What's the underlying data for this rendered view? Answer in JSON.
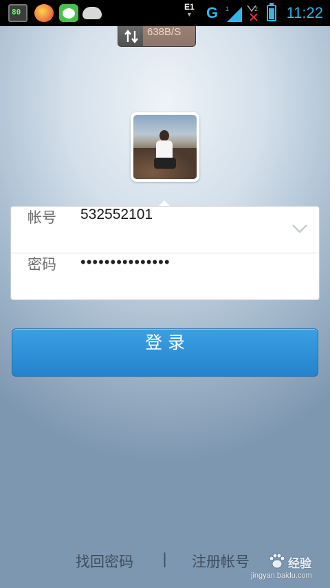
{
  "status_bar": {
    "app_icons": [
      "battery-app-icon",
      "plus-app-icon",
      "rabbit-app-icon",
      "android-app-icon"
    ],
    "app1_text": "80",
    "network_type_top": "E1",
    "network_g": "G",
    "signal1_label": "1",
    "signal2_label": "2",
    "time": "11:22",
    "accent_color": "#33b5e5"
  },
  "net_speed": {
    "value": "638B/S",
    "icon": "up-down-arrows-icon"
  },
  "login_form": {
    "account_label": "帐号",
    "account_value": "532552101",
    "password_label": "密码",
    "password_value": "•••••••••••••••",
    "dropdown_icon": "chevron-down-icon"
  },
  "login_button": {
    "label": "登录",
    "color": "#2f93da"
  },
  "bottom_links": {
    "find_password": "找回密码",
    "separator": "|",
    "register": "注册帐号"
  },
  "watermark": {
    "brand": "经验",
    "url": "jingyan.baidu.com"
  }
}
